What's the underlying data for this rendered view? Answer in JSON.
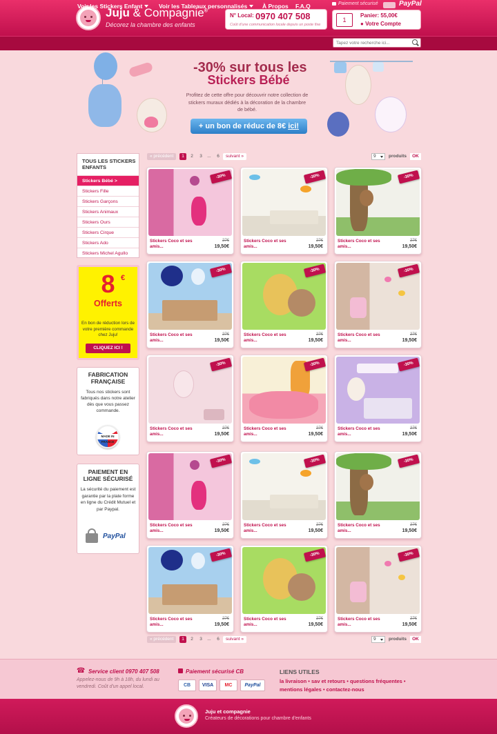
{
  "header": {
    "brand_name": "Juju",
    "brand_amp": " & Compagnie",
    "brand_reg": "®",
    "tagline": "Décorez la chambre des enfants",
    "phone_label": "N° Local:",
    "phone_number": "0970 407 508",
    "phone_note": "Coût d'une communication locale depuis un poste fixe",
    "secure_label": "Paiement sécurisé",
    "paypal_label": "PayPal",
    "cart_label": "Panier: 55,00€",
    "cart_count": "1",
    "account_label": "Votre Compte"
  },
  "nav": {
    "items": [
      "Voir les Stickers Enfant",
      "Voir les Tableaux personnalisés",
      "À Propos",
      "F.A.Q"
    ],
    "search_placeholder": "Tapez votre recherche ici..."
  },
  "hero": {
    "title_line1": "-30% sur tous les",
    "title_line2": "Stickers Bébé",
    "text": "Profitez de cette offre pour découvrir notre collection de stickers muraux dédiés à la décoration de la chambre de bébé.",
    "button_prefix": "+ un bon de réduc de 8€ ",
    "button_link": "ici!"
  },
  "sidebar": {
    "categories_title": "TOUS LES STICKERS ENFANTS",
    "categories": [
      "Stickers Bébé >",
      "Stickers Fille",
      "Stickers Garçons",
      "Stickers Animaux",
      "Stickers Ours",
      "Stickers Cirque",
      "Stickers Ado",
      "Stickers Michel Agullo"
    ],
    "promo": {
      "amount": "8",
      "currency": "€",
      "title": "Offerts",
      "text": "En bon de réduction lors de votre première commande chez Juju!",
      "button": "CLIQUEZ ICI !"
    },
    "fabrication": {
      "title": "FABRICATION FRANÇAISE",
      "text": "Tous nos stickers sont fabriqués dans notre atelier dès que vous passez commande.",
      "badge": "MADE IN FRANCE"
    },
    "payment": {
      "title": "PAIEMENT EN LIGNE SÉCURISÉ",
      "text": "La sécurité du paiement est garantie par la plate forme en ligne du Crédit Mutuel et par Paypal.",
      "paypal": "PayPal"
    }
  },
  "pagination": {
    "prev": "« précédent",
    "pages": [
      "1",
      "2",
      "3"
    ],
    "ellipsis": "...",
    "last": "6",
    "next": "suivant »",
    "per_page": "9",
    "per_page_label": "produits",
    "ok": "OK"
  },
  "product_defaults": {
    "name": "Stickers Coco et ses amis...",
    "old_price": "27€",
    "price": "19,50€",
    "badge": "-30%"
  },
  "products": [
    {
      "scene": "pink"
    },
    {
      "scene": "fish"
    },
    {
      "scene": "tree"
    },
    {
      "scene": "blue"
    },
    {
      "scene": "green"
    },
    {
      "scene": "wood"
    },
    {
      "scene": "rose"
    },
    {
      "scene": "rug"
    },
    {
      "scene": "lilac"
    },
    {
      "scene": "pink"
    },
    {
      "scene": "fish"
    },
    {
      "scene": "tree"
    },
    {
      "scene": "blue"
    },
    {
      "scene": "green"
    },
    {
      "scene": "wood"
    }
  ],
  "footer": {
    "service_title": "Service client 0970 407 508",
    "service_text": "Appelez-nous de 9h à 18h, du lundi au vendredi. Coût d'un appel local.",
    "secure_title": "Paiement sécurisé CB",
    "cards": [
      "CB",
      "VISA",
      "MC",
      "PayPal"
    ],
    "links_title": "LIENS UTILES",
    "links": [
      "la livraison",
      "sav et retours",
      "questions fréquentes",
      "mentions légales",
      "contactez-nous"
    ],
    "bottom_name": "Juju et compagnie",
    "bottom_tagline": "Créateurs de décorations pour chambre d'enfants"
  },
  "colors": {
    "brand": "#c0104d",
    "accent_pink": "#e51f63",
    "background": "#f9d9dd",
    "promo_yellow": "#fff200"
  }
}
